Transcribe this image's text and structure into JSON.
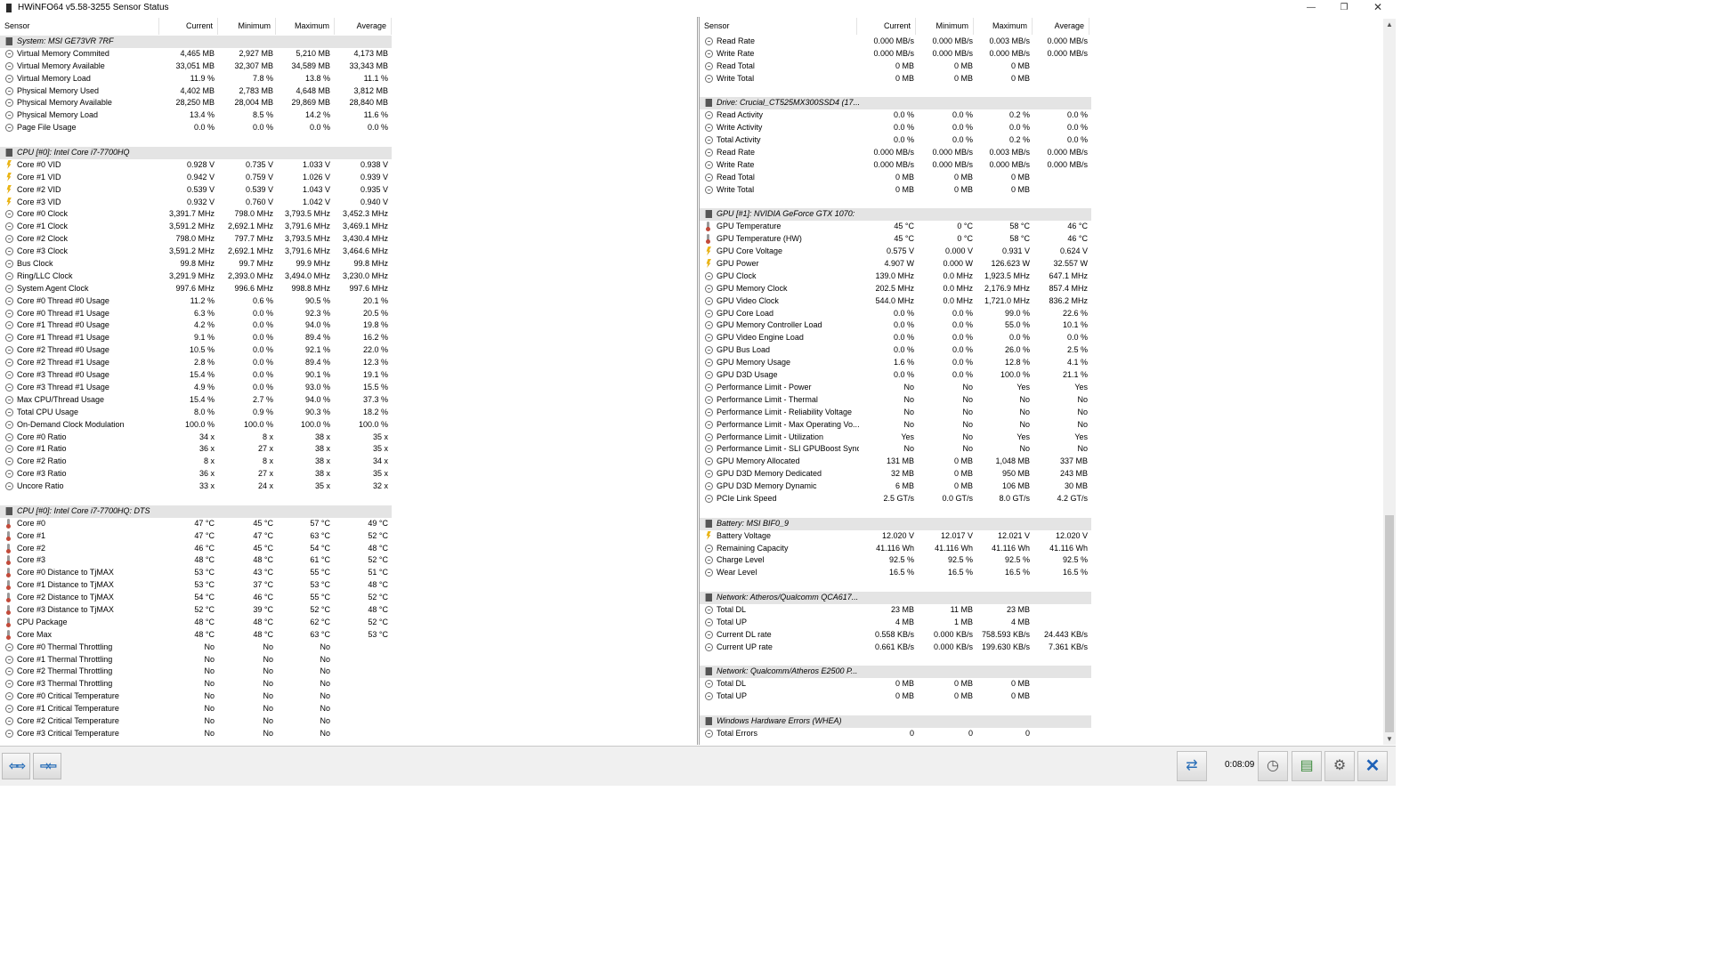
{
  "window": {
    "title": "HWiNFO64 v5.58-3255 Sensor Status",
    "minimize": "—",
    "restore": "❐",
    "close": "✕"
  },
  "headers": {
    "sensor": "Sensor",
    "current": "Current",
    "minimum": "Minimum",
    "maximum": "Maximum",
    "average": "Average"
  },
  "left_rows": [
    {
      "t": "group",
      "name": "System: MSI GE73VR 7RF"
    },
    {
      "i": "clock",
      "name": "Virtual Memory Commited",
      "cur": "4,465 MB",
      "min": "2,927 MB",
      "max": "5,210 MB",
      "avg": "4,173 MB"
    },
    {
      "i": "clock",
      "name": "Virtual Memory Available",
      "cur": "33,051 MB",
      "min": "32,307 MB",
      "max": "34,589 MB",
      "avg": "33,343 MB"
    },
    {
      "i": "clock",
      "name": "Virtual Memory Load",
      "cur": "11.9 %",
      "min": "7.8 %",
      "max": "13.8 %",
      "avg": "11.1 %"
    },
    {
      "i": "clock",
      "name": "Physical Memory Used",
      "cur": "4,402 MB",
      "min": "2,783 MB",
      "max": "4,648 MB",
      "avg": "3,812 MB"
    },
    {
      "i": "clock",
      "name": "Physical Memory Available",
      "cur": "28,250 MB",
      "min": "28,004 MB",
      "max": "29,869 MB",
      "avg": "28,840 MB"
    },
    {
      "i": "clock",
      "name": "Physical Memory Load",
      "cur": "13.4 %",
      "min": "8.5 %",
      "max": "14.2 %",
      "avg": "11.6 %"
    },
    {
      "i": "clock",
      "name": "Page File Usage",
      "cur": "0.0 %",
      "min": "0.0 %",
      "max": "0.0 %",
      "avg": "0.0 %"
    },
    {
      "t": "blank"
    },
    {
      "t": "group",
      "name": "CPU [#0]: Intel Core i7-7700HQ"
    },
    {
      "i": "volt",
      "name": "Core #0 VID",
      "cur": "0.928 V",
      "min": "0.735 V",
      "max": "1.033 V",
      "avg": "0.938 V"
    },
    {
      "i": "volt",
      "name": "Core #1 VID",
      "cur": "0.942 V",
      "min": "0.759 V",
      "max": "1.026 V",
      "avg": "0.939 V"
    },
    {
      "i": "volt",
      "name": "Core #2 VID",
      "cur": "0.539 V",
      "min": "0.539 V",
      "max": "1.043 V",
      "avg": "0.935 V"
    },
    {
      "i": "volt",
      "name": "Core #3 VID",
      "cur": "0.932 V",
      "min": "0.760 V",
      "max": "1.042 V",
      "avg": "0.940 V"
    },
    {
      "i": "clock",
      "name": "Core #0 Clock",
      "cur": "3,391.7 MHz",
      "min": "798.0 MHz",
      "max": "3,793.5 MHz",
      "avg": "3,452.3 MHz"
    },
    {
      "i": "clock",
      "name": "Core #1 Clock",
      "cur": "3,591.2 MHz",
      "min": "2,692.1 MHz",
      "max": "3,791.6 MHz",
      "avg": "3,469.1 MHz"
    },
    {
      "i": "clock",
      "name": "Core #2 Clock",
      "cur": "798.0 MHz",
      "min": "797.7 MHz",
      "max": "3,793.5 MHz",
      "avg": "3,430.4 MHz"
    },
    {
      "i": "clock",
      "name": "Core #3 Clock",
      "cur": "3,591.2 MHz",
      "min": "2,692.1 MHz",
      "max": "3,791.6 MHz",
      "avg": "3,464.6 MHz"
    },
    {
      "i": "clock",
      "name": "Bus Clock",
      "cur": "99.8 MHz",
      "min": "99.7 MHz",
      "max": "99.9 MHz",
      "avg": "99.8 MHz"
    },
    {
      "i": "clock",
      "name": "Ring/LLC Clock",
      "cur": "3,291.9 MHz",
      "min": "2,393.0 MHz",
      "max": "3,494.0 MHz",
      "avg": "3,230.0 MHz"
    },
    {
      "i": "clock",
      "name": "System Agent Clock",
      "cur": "997.6 MHz",
      "min": "996.6 MHz",
      "max": "998.8 MHz",
      "avg": "997.6 MHz"
    },
    {
      "i": "clock",
      "name": "Core #0 Thread #0 Usage",
      "cur": "11.2 %",
      "min": "0.6 %",
      "max": "90.5 %",
      "avg": "20.1 %"
    },
    {
      "i": "clock",
      "name": "Core #0 Thread #1 Usage",
      "cur": "6.3 %",
      "min": "0.0 %",
      "max": "92.3 %",
      "avg": "20.5 %"
    },
    {
      "i": "clock",
      "name": "Core #1 Thread #0 Usage",
      "cur": "4.2 %",
      "min": "0.0 %",
      "max": "94.0 %",
      "avg": "19.8 %"
    },
    {
      "i": "clock",
      "name": "Core #1 Thread #1 Usage",
      "cur": "9.1 %",
      "min": "0.0 %",
      "max": "89.4 %",
      "avg": "16.2 %"
    },
    {
      "i": "clock",
      "name": "Core #2 Thread #0 Usage",
      "cur": "10.5 %",
      "min": "0.0 %",
      "max": "92.1 %",
      "avg": "22.0 %"
    },
    {
      "i": "clock",
      "name": "Core #2 Thread #1 Usage",
      "cur": "2.8 %",
      "min": "0.0 %",
      "max": "89.4 %",
      "avg": "12.3 %"
    },
    {
      "i": "clock",
      "name": "Core #3 Thread #0 Usage",
      "cur": "15.4 %",
      "min": "0.0 %",
      "max": "90.1 %",
      "avg": "19.1 %"
    },
    {
      "i": "clock",
      "name": "Core #3 Thread #1 Usage",
      "cur": "4.9 %",
      "min": "0.0 %",
      "max": "93.0 %",
      "avg": "15.5 %"
    },
    {
      "i": "clock",
      "name": "Max CPU/Thread Usage",
      "cur": "15.4 %",
      "min": "2.7 %",
      "max": "94.0 %",
      "avg": "37.3 %"
    },
    {
      "i": "clock",
      "name": "Total CPU Usage",
      "cur": "8.0 %",
      "min": "0.9 %",
      "max": "90.3 %",
      "avg": "18.2 %"
    },
    {
      "i": "clock",
      "name": "On-Demand Clock Modulation",
      "cur": "100.0 %",
      "min": "100.0 %",
      "max": "100.0 %",
      "avg": "100.0 %"
    },
    {
      "i": "clock",
      "name": "Core #0 Ratio",
      "cur": "34 x",
      "min": "8 x",
      "max": "38 x",
      "avg": "35 x"
    },
    {
      "i": "clock",
      "name": "Core #1 Ratio",
      "cur": "36 x",
      "min": "27 x",
      "max": "38 x",
      "avg": "35 x"
    },
    {
      "i": "clock",
      "name": "Core #2 Ratio",
      "cur": "8 x",
      "min": "8 x",
      "max": "38 x",
      "avg": "34 x"
    },
    {
      "i": "clock",
      "name": "Core #3 Ratio",
      "cur": "36 x",
      "min": "27 x",
      "max": "38 x",
      "avg": "35 x"
    },
    {
      "i": "clock",
      "name": "Uncore Ratio",
      "cur": "33 x",
      "min": "24 x",
      "max": "35 x",
      "avg": "32 x"
    },
    {
      "t": "blank"
    },
    {
      "t": "group",
      "name": "CPU [#0]: Intel Core i7-7700HQ: DTS"
    },
    {
      "i": "temp",
      "name": "Core #0",
      "cur": "47 °C",
      "min": "45 °C",
      "max": "57 °C",
      "avg": "49 °C"
    },
    {
      "i": "temp",
      "name": "Core #1",
      "cur": "47 °C",
      "min": "47 °C",
      "max": "63 °C",
      "avg": "52 °C"
    },
    {
      "i": "temp",
      "name": "Core #2",
      "cur": "46 °C",
      "min": "45 °C",
      "max": "54 °C",
      "avg": "48 °C"
    },
    {
      "i": "temp",
      "name": "Core #3",
      "cur": "48 °C",
      "min": "48 °C",
      "max": "61 °C",
      "avg": "52 °C"
    },
    {
      "i": "temp",
      "name": "Core #0 Distance to TjMAX",
      "cur": "53 °C",
      "min": "43 °C",
      "max": "55 °C",
      "avg": "51 °C"
    },
    {
      "i": "temp",
      "name": "Core #1 Distance to TjMAX",
      "cur": "53 °C",
      "min": "37 °C",
      "max": "53 °C",
      "avg": "48 °C"
    },
    {
      "i": "temp",
      "name": "Core #2 Distance to TjMAX",
      "cur": "54 °C",
      "min": "46 °C",
      "max": "55 °C",
      "avg": "52 °C"
    },
    {
      "i": "temp",
      "name": "Core #3 Distance to TjMAX",
      "cur": "52 °C",
      "min": "39 °C",
      "max": "52 °C",
      "avg": "48 °C"
    },
    {
      "i": "temp",
      "name": "CPU Package",
      "cur": "48 °C",
      "min": "48 °C",
      "max": "62 °C",
      "avg": "52 °C"
    },
    {
      "i": "temp",
      "name": "Core Max",
      "cur": "48 °C",
      "min": "48 °C",
      "max": "63 °C",
      "avg": "53 °C"
    },
    {
      "i": "clock",
      "name": "Core #0 Thermal Throttling",
      "cur": "No",
      "min": "No",
      "max": "No",
      "avg": ""
    },
    {
      "i": "clock",
      "name": "Core #1 Thermal Throttling",
      "cur": "No",
      "min": "No",
      "max": "No",
      "avg": ""
    },
    {
      "i": "clock",
      "name": "Core #2 Thermal Throttling",
      "cur": "No",
      "min": "No",
      "max": "No",
      "avg": ""
    },
    {
      "i": "clock",
      "name": "Core #3 Thermal Throttling",
      "cur": "No",
      "min": "No",
      "max": "No",
      "avg": ""
    },
    {
      "i": "clock",
      "name": "Core #0 Critical Temperature",
      "cur": "No",
      "min": "No",
      "max": "No",
      "avg": ""
    },
    {
      "i": "clock",
      "name": "Core #1 Critical Temperature",
      "cur": "No",
      "min": "No",
      "max": "No",
      "avg": ""
    },
    {
      "i": "clock",
      "name": "Core #2 Critical Temperature",
      "cur": "No",
      "min": "No",
      "max": "No",
      "avg": ""
    },
    {
      "i": "clock",
      "name": "Core #3 Critical Temperature",
      "cur": "No",
      "min": "No",
      "max": "No",
      "avg": ""
    }
  ],
  "right_rows": [
    {
      "i": "clock",
      "name": "Read Rate",
      "cur": "0.000 MB/s",
      "min": "0.000 MB/s",
      "max": "0.003 MB/s",
      "avg": "0.000 MB/s"
    },
    {
      "i": "clock",
      "name": "Write Rate",
      "cur": "0.000 MB/s",
      "min": "0.000 MB/s",
      "max": "0.000 MB/s",
      "avg": "0.000 MB/s"
    },
    {
      "i": "clock",
      "name": "Read Total",
      "cur": "0 MB",
      "min": "0 MB",
      "max": "0 MB",
      "avg": ""
    },
    {
      "i": "clock",
      "name": "Write Total",
      "cur": "0 MB",
      "min": "0 MB",
      "max": "0 MB",
      "avg": ""
    },
    {
      "t": "blank"
    },
    {
      "t": "group",
      "name": "Drive: Crucial_CT525MX300SSD4 (17..."
    },
    {
      "i": "clock",
      "name": "Read Activity",
      "cur": "0.0 %",
      "min": "0.0 %",
      "max": "0.2 %",
      "avg": "0.0 %"
    },
    {
      "i": "clock",
      "name": "Write Activity",
      "cur": "0.0 %",
      "min": "0.0 %",
      "max": "0.0 %",
      "avg": "0.0 %"
    },
    {
      "i": "clock",
      "name": "Total Activity",
      "cur": "0.0 %",
      "min": "0.0 %",
      "max": "0.2 %",
      "avg": "0.0 %"
    },
    {
      "i": "clock",
      "name": "Read Rate",
      "cur": "0.000 MB/s",
      "min": "0.000 MB/s",
      "max": "0.003 MB/s",
      "avg": "0.000 MB/s"
    },
    {
      "i": "clock",
      "name": "Write Rate",
      "cur": "0.000 MB/s",
      "min": "0.000 MB/s",
      "max": "0.000 MB/s",
      "avg": "0.000 MB/s"
    },
    {
      "i": "clock",
      "name": "Read Total",
      "cur": "0 MB",
      "min": "0 MB",
      "max": "0 MB",
      "avg": ""
    },
    {
      "i": "clock",
      "name": "Write Total",
      "cur": "0 MB",
      "min": "0 MB",
      "max": "0 MB",
      "avg": ""
    },
    {
      "t": "blank"
    },
    {
      "t": "group",
      "name": "GPU [#1]: NVIDIA GeForce GTX 1070:"
    },
    {
      "i": "temp",
      "name": "GPU Temperature",
      "cur": "45 °C",
      "min": "0 °C",
      "max": "58 °C",
      "avg": "46 °C"
    },
    {
      "i": "temp",
      "name": "GPU Temperature (HW)",
      "cur": "45 °C",
      "min": "0 °C",
      "max": "58 °C",
      "avg": "46 °C"
    },
    {
      "i": "volt",
      "name": "GPU Core Voltage",
      "cur": "0.575 V",
      "min": "0.000 V",
      "max": "0.931 V",
      "avg": "0.624 V"
    },
    {
      "i": "volt",
      "name": "GPU Power",
      "cur": "4.907 W",
      "min": "0.000 W",
      "max": "126.623 W",
      "avg": "32.557 W"
    },
    {
      "i": "clock",
      "name": "GPU Clock",
      "cur": "139.0 MHz",
      "min": "0.0 MHz",
      "max": "1,923.5 MHz",
      "avg": "647.1 MHz"
    },
    {
      "i": "clock",
      "name": "GPU Memory Clock",
      "cur": "202.5 MHz",
      "min": "0.0 MHz",
      "max": "2,176.9 MHz",
      "avg": "857.4 MHz"
    },
    {
      "i": "clock",
      "name": "GPU Video Clock",
      "cur": "544.0 MHz",
      "min": "0.0 MHz",
      "max": "1,721.0 MHz",
      "avg": "836.2 MHz"
    },
    {
      "i": "clock",
      "name": "GPU Core Load",
      "cur": "0.0 %",
      "min": "0.0 %",
      "max": "99.0 %",
      "avg": "22.6 %"
    },
    {
      "i": "clock",
      "name": "GPU Memory Controller Load",
      "cur": "0.0 %",
      "min": "0.0 %",
      "max": "55.0 %",
      "avg": "10.1 %"
    },
    {
      "i": "clock",
      "name": "GPU Video Engine Load",
      "cur": "0.0 %",
      "min": "0.0 %",
      "max": "0.0 %",
      "avg": "0.0 %"
    },
    {
      "i": "clock",
      "name": "GPU Bus Load",
      "cur": "0.0 %",
      "min": "0.0 %",
      "max": "26.0 %",
      "avg": "2.5 %"
    },
    {
      "i": "clock",
      "name": "GPU Memory Usage",
      "cur": "1.6 %",
      "min": "0.0 %",
      "max": "12.8 %",
      "avg": "4.1 %"
    },
    {
      "i": "clock",
      "name": "GPU D3D Usage",
      "cur": "0.0 %",
      "min": "0.0 %",
      "max": "100.0 %",
      "avg": "21.1 %"
    },
    {
      "i": "clock",
      "name": "Performance Limit - Power",
      "cur": "No",
      "min": "No",
      "max": "Yes",
      "avg": "Yes"
    },
    {
      "i": "clock",
      "name": "Performance Limit - Thermal",
      "cur": "No",
      "min": "No",
      "max": "No",
      "avg": "No"
    },
    {
      "i": "clock",
      "name": "Performance Limit - Reliability Voltage",
      "cur": "No",
      "min": "No",
      "max": "No",
      "avg": "No"
    },
    {
      "i": "clock",
      "name": "Performance Limit - Max Operating Vo...",
      "cur": "No",
      "min": "No",
      "max": "No",
      "avg": "No"
    },
    {
      "i": "clock",
      "name": "Performance Limit - Utilization",
      "cur": "Yes",
      "min": "No",
      "max": "Yes",
      "avg": "Yes"
    },
    {
      "i": "clock",
      "name": "Performance Limit - SLI GPUBoost Sync",
      "cur": "No",
      "min": "No",
      "max": "No",
      "avg": "No"
    },
    {
      "i": "clock",
      "name": "GPU Memory Allocated",
      "cur": "131 MB",
      "min": "0 MB",
      "max": "1,048 MB",
      "avg": "337 MB"
    },
    {
      "i": "clock",
      "name": "GPU D3D Memory Dedicated",
      "cur": "32 MB",
      "min": "0 MB",
      "max": "950 MB",
      "avg": "243 MB"
    },
    {
      "i": "clock",
      "name": "GPU D3D Memory Dynamic",
      "cur": "6 MB",
      "min": "0 MB",
      "max": "106 MB",
      "avg": "30 MB"
    },
    {
      "i": "clock",
      "name": "PCIe Link Speed",
      "cur": "2.5 GT/s",
      "min": "0.0 GT/s",
      "max": "8.0 GT/s",
      "avg": "4.2 GT/s"
    },
    {
      "t": "blank"
    },
    {
      "t": "group",
      "name": "Battery: MSI BIF0_9"
    },
    {
      "i": "volt",
      "name": "Battery Voltage",
      "cur": "12.020 V",
      "min": "12.017 V",
      "max": "12.021 V",
      "avg": "12.020 V"
    },
    {
      "i": "clock",
      "name": "Remaining Capacity",
      "cur": "41.116 Wh",
      "min": "41.116 Wh",
      "max": "41.116 Wh",
      "avg": "41.116 Wh"
    },
    {
      "i": "clock",
      "name": "Charge Level",
      "cur": "92.5 %",
      "min": "92.5 %",
      "max": "92.5 %",
      "avg": "92.5 %"
    },
    {
      "i": "clock",
      "name": "Wear Level",
      "cur": "16.5 %",
      "min": "16.5 %",
      "max": "16.5 %",
      "avg": "16.5 %"
    },
    {
      "t": "blank"
    },
    {
      "t": "group",
      "name": "Network: Atheros/Qualcomm QCA617..."
    },
    {
      "i": "clock",
      "name": "Total DL",
      "cur": "23 MB",
      "min": "11 MB",
      "max": "23 MB",
      "avg": ""
    },
    {
      "i": "clock",
      "name": "Total UP",
      "cur": "4 MB",
      "min": "1 MB",
      "max": "4 MB",
      "avg": ""
    },
    {
      "i": "clock",
      "name": "Current DL rate",
      "cur": "0.558 KB/s",
      "min": "0.000 KB/s",
      "max": "758.593 KB/s",
      "avg": "24.443 KB/s"
    },
    {
      "i": "clock",
      "name": "Current UP rate",
      "cur": "0.661 KB/s",
      "min": "0.000 KB/s",
      "max": "199.630 KB/s",
      "avg": "7.361 KB/s"
    },
    {
      "t": "blank"
    },
    {
      "t": "group",
      "name": "Network: Qualcomm/Atheros E2500 P..."
    },
    {
      "i": "clock",
      "name": "Total DL",
      "cur": "0 MB",
      "min": "0 MB",
      "max": "0 MB",
      "avg": ""
    },
    {
      "i": "clock",
      "name": "Total UP",
      "cur": "0 MB",
      "min": "0 MB",
      "max": "0 MB",
      "avg": ""
    },
    {
      "t": "blank"
    },
    {
      "t": "group",
      "name": "Windows Hardware Errors (WHEA)"
    },
    {
      "i": "clock",
      "name": "Total Errors",
      "cur": "0",
      "min": "0",
      "max": "0",
      "avg": ""
    }
  ],
  "toolbar": {
    "nav_left": "⇦⇨",
    "nav_right": "⇨⇦",
    "network_icon": "⇄",
    "timer": "0:08:09",
    "clock_icon": "◷",
    "report_icon": "▤",
    "settings_icon": "⚙",
    "close_icon": "✕"
  }
}
